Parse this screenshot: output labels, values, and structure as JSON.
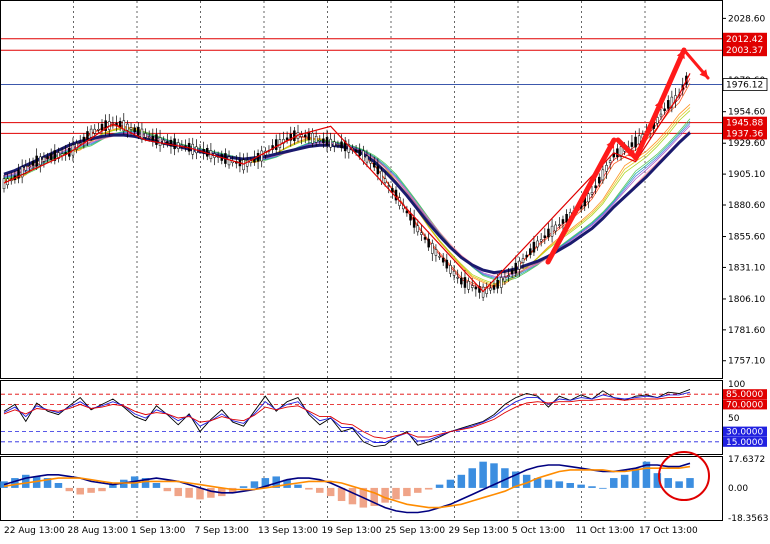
{
  "chart_data": [
    {
      "type": "line",
      "panel": "price",
      "y_ticks": [
        "2028.60",
        "2003.60",
        "1979.60",
        "1954.60",
        "1929.60",
        "1905.10",
        "1880.60",
        "1855.60",
        "1831.10",
        "1806.10",
        "1781.60",
        "1757.10"
      ],
      "ylim": [
        1745,
        2040
      ],
      "x_labels": [
        "22 Aug 13:00",
        "28 Aug 13:00",
        "1 Sep 13:00",
        "7 Sep 13:00",
        "13 Sep 13:00",
        "19 Sep 13:00",
        "25 Sep 13:00",
        "29 Sep 13:00",
        "5 Oct 13:00",
        "11 Oct 13:00",
        "17 Oct 13:00"
      ],
      "current_price": "1976.12",
      "levels": [
        {
          "label": "2012.42",
          "value": 2012.42,
          "color": "#e00000"
        },
        {
          "label": "2003.37",
          "value": 2003.37,
          "color": "#e00000"
        },
        {
          "label": "1945.88",
          "value": 1945.88,
          "color": "#e00000"
        },
        {
          "label": "1937.36",
          "value": 1937.36,
          "color": "#e00000"
        }
      ],
      "price_path": [
        1898,
        1902,
        1910,
        1915,
        1918,
        1920,
        1922,
        1930,
        1938,
        1942,
        1945,
        1944,
        1940,
        1936,
        1932,
        1930,
        1928,
        1926,
        1924,
        1921,
        1918,
        1915,
        1913,
        1916,
        1922,
        1928,
        1933,
        1936,
        1935,
        1932,
        1930,
        1928,
        1925,
        1920,
        1912,
        1900,
        1888,
        1875,
        1862,
        1850,
        1840,
        1830,
        1820,
        1816,
        1812,
        1815,
        1822,
        1830,
        1840,
        1850,
        1858,
        1865,
        1872,
        1880,
        1890,
        1905,
        1920,
        1925,
        1930,
        1938,
        1948,
        1960,
        1968,
        1985
      ],
      "ma_slow": [
        1905,
        1908,
        1912,
        1916,
        1920,
        1924,
        1928,
        1931,
        1933,
        1935,
        1936,
        1936,
        1935,
        1933,
        1931,
        1929,
        1927,
        1925,
        1923,
        1921,
        1919,
        1918,
        1917,
        1918,
        1919,
        1921,
        1923,
        1925,
        1927,
        1928,
        1928,
        1927,
        1925,
        1921,
        1915,
        1907,
        1898,
        1888,
        1877,
        1866,
        1856,
        1847,
        1839,
        1833,
        1829,
        1827,
        1828,
        1830,
        1833,
        1836,
        1840,
        1845,
        1850,
        1856,
        1862,
        1870,
        1879,
        1887,
        1895,
        1903,
        1912,
        1921,
        1930,
        1938
      ]
    },
    {
      "type": "line",
      "panel": "oscillator",
      "ylim": [
        0,
        100
      ],
      "y_ticks": [
        "100",
        "85.0000",
        "70.0000",
        "50",
        "30.0000",
        "15.0000"
      ],
      "levels": [
        {
          "label": "85.0000",
          "value": 85,
          "color": "#e00000"
        },
        {
          "label": "70.0000",
          "value": 70,
          "color": "#e00000"
        },
        {
          "label": "30.0000",
          "value": 30,
          "color": "#2020e0"
        },
        {
          "label": "15.0000",
          "value": 15,
          "color": "#2020e0"
        }
      ],
      "series": [
        {
          "color": "#000000",
          "values": [
            60,
            70,
            45,
            72,
            60,
            55,
            68,
            80,
            62,
            70,
            78,
            66,
            52,
            46,
            68,
            55,
            40,
            56,
            30,
            48,
            62,
            44,
            38,
            60,
            82,
            60,
            74,
            80,
            55,
            40,
            50,
            30,
            35,
            15,
            8,
            10,
            22,
            30,
            10,
            15,
            22,
            30,
            35,
            40,
            45,
            55,
            70,
            80,
            86,
            82,
            66,
            82,
            76,
            84,
            78,
            90,
            80,
            76,
            82,
            84,
            80,
            88,
            86,
            92
          ]
        },
        {
          "color": "#2020e0",
          "values": [
            58,
            66,
            52,
            68,
            62,
            58,
            66,
            74,
            64,
            68,
            74,
            68,
            56,
            50,
            62,
            56,
            46,
            54,
            38,
            46,
            56,
            46,
            42,
            56,
            74,
            62,
            70,
            74,
            58,
            46,
            50,
            36,
            36,
            22,
            14,
            14,
            22,
            28,
            16,
            18,
            24,
            30,
            34,
            38,
            44,
            52,
            64,
            74,
            80,
            80,
            70,
            78,
            76,
            80,
            78,
            84,
            80,
            78,
            80,
            82,
            80,
            84,
            84,
            88
          ]
        },
        {
          "color": "#e00000",
          "values": [
            56,
            62,
            56,
            64,
            62,
            60,
            64,
            70,
            64,
            66,
            70,
            68,
            60,
            55,
            58,
            56,
            50,
            52,
            44,
            46,
            52,
            48,
            46,
            54,
            66,
            62,
            66,
            68,
            60,
            52,
            52,
            42,
            40,
            30,
            22,
            20,
            24,
            28,
            22,
            22,
            26,
            30,
            33,
            36,
            42,
            48,
            58,
            66,
            72,
            74,
            72,
            74,
            74,
            76,
            76,
            78,
            78,
            76,
            78,
            78,
            78,
            80,
            80,
            82
          ]
        }
      ]
    },
    {
      "type": "bar",
      "panel": "macd",
      "ylim": [
        -18.3563,
        17.6372
      ],
      "y_ticks": [
        "17.6372",
        "0.00",
        "-18.3563"
      ],
      "histogram": [
        4,
        6,
        8,
        7,
        6,
        3,
        -2,
        -4,
        -3,
        -2,
        2,
        5,
        7,
        6,
        3,
        -2,
        -5,
        -6,
        -7,
        -6,
        -5,
        -3,
        1,
        4,
        6,
        7,
        5,
        2,
        -1,
        -3,
        -5,
        -8,
        -10,
        -12,
        -11,
        -9,
        -7,
        -5,
        -3,
        -1,
        2,
        5,
        8,
        12,
        16,
        15,
        12,
        10,
        8,
        6,
        5,
        4,
        3,
        2,
        1,
        0,
        6,
        8,
        12,
        16,
        9,
        6,
        4,
        6
      ],
      "series": [
        {
          "color": "#000080",
          "values": [
            2,
            4,
            6,
            7,
            8,
            8,
            7,
            6,
            4,
            3,
            2,
            3,
            4,
            5,
            6,
            5,
            4,
            2,
            0,
            -2,
            -3,
            -3,
            -2,
            -1,
            1,
            3,
            5,
            6,
            6,
            5,
            3,
            0,
            -3,
            -6,
            -9,
            -12,
            -14,
            -15,
            -15,
            -14,
            -12,
            -10,
            -7,
            -4,
            -1,
            2,
            5,
            8,
            11,
            13,
            14,
            14,
            13,
            12,
            11,
            10,
            10,
            11,
            12,
            14,
            14,
            13,
            13,
            15
          ]
        },
        {
          "color": "#ff8c00",
          "values": [
            1,
            2,
            3,
            4,
            5,
            6,
            6,
            6,
            5,
            4,
            3,
            3,
            3,
            4,
            4,
            4,
            4,
            3,
            2,
            1,
            0,
            -1,
            -1,
            -1,
            0,
            1,
            2,
            3,
            4,
            4,
            4,
            3,
            1,
            -1,
            -3,
            -6,
            -8,
            -10,
            -11,
            -12,
            -12,
            -11,
            -10,
            -8,
            -6,
            -4,
            -2,
            1,
            3,
            6,
            8,
            10,
            11,
            11,
            11,
            11,
            10,
            10,
            11,
            12,
            12,
            12,
            12,
            13
          ]
        }
      ]
    }
  ]
}
